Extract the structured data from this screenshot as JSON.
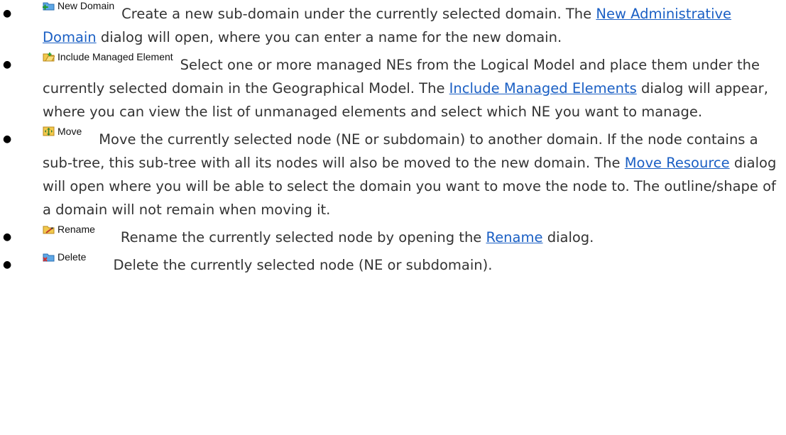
{
  "items": [
    {
      "label": "New Domain",
      "before": "Create a new sub-domain under the currently selected domain. The ",
      "link": "New Administrative Domain",
      "after": " dialog will open, where you can enter a name for the new domain."
    },
    {
      "label": "Include Managed Element",
      "before": "Select one or more managed NEs from the Logical Model and place them under the currently selected domain in the Geographical Model. The ",
      "link": "Include Managed Elements",
      "after": " dialog will appear, where you can view the list of unmanaged elements and select which NE you want to manage."
    },
    {
      "label": "Move",
      "before": "Move the currently selected node (NE or subdomain) to another domain. If the node contains a sub-tree, this sub-tree with all its nodes will also be moved to the new domain. The ",
      "link": "Move Resource",
      "after": " dialog will open where you will be able to select the domain you want to move the node to. The outline/shape of a domain will not remain when moving it."
    },
    {
      "label": "Rename",
      "before": "Rename the currently selected node by opening the ",
      "link": "Rename",
      "after": " dialog."
    },
    {
      "label": "Delete",
      "before": "Delete the currently selected node (NE or subdomain).",
      "link": "",
      "after": ""
    }
  ]
}
